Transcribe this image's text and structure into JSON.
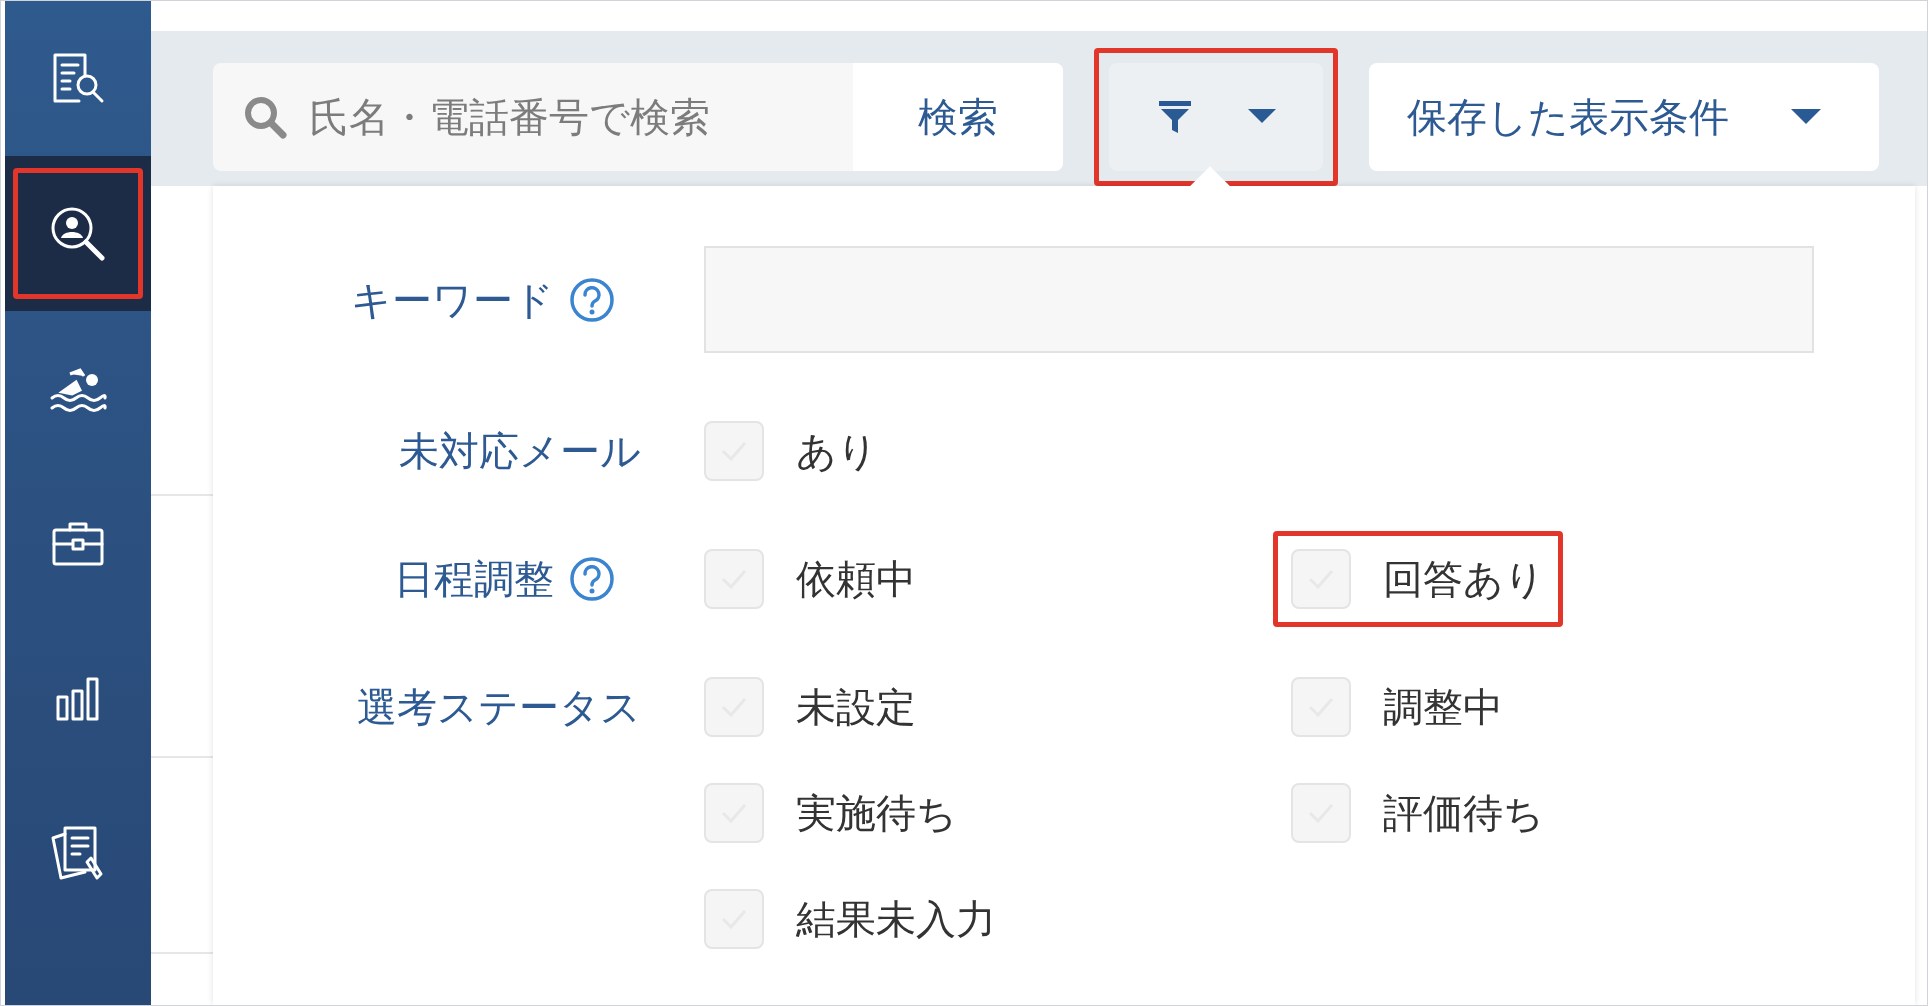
{
  "sidebar": {
    "items": [
      {
        "kind": "document-search",
        "selected": false,
        "highlighted": false
      },
      {
        "kind": "person-search",
        "selected": true,
        "highlighted": true
      },
      {
        "kind": "swimmer",
        "selected": false,
        "highlighted": false
      },
      {
        "kind": "briefcase",
        "selected": false,
        "highlighted": false
      },
      {
        "kind": "bar-chart",
        "selected": false,
        "highlighted": false
      },
      {
        "kind": "documents",
        "selected": false,
        "highlighted": false
      }
    ]
  },
  "search": {
    "placeholder": "氏名・電話番号で検索",
    "button": "検索"
  },
  "filter_button": {
    "expanded": true,
    "highlighted": true
  },
  "saved_conditions": {
    "label": "保存した表示条件"
  },
  "filters": [
    {
      "kind": "text",
      "label": "キーワード",
      "help": true
    },
    {
      "kind": "checkboxes",
      "label": "未対応メール",
      "help": false,
      "options": [
        {
          "label": "あり",
          "checked": false,
          "highlighted": false
        }
      ]
    },
    {
      "kind": "checkboxes",
      "label": "日程調整",
      "help": true,
      "options": [
        {
          "label": "依頼中",
          "checked": false,
          "highlighted": false
        },
        {
          "label": "回答あり",
          "checked": false,
          "highlighted": true
        }
      ]
    },
    {
      "kind": "checkboxes",
      "label": "選考ステータス",
      "help": false,
      "options": [
        {
          "label": "未設定",
          "checked": false,
          "highlighted": false
        },
        {
          "label": "調整中",
          "checked": false,
          "highlighted": false
        },
        {
          "label": "実施待ち",
          "checked": false,
          "highlighted": false
        },
        {
          "label": "評価待ち",
          "checked": false,
          "highlighted": false
        },
        {
          "label": "結果未入力",
          "checked": false,
          "highlighted": false
        }
      ]
    }
  ]
}
